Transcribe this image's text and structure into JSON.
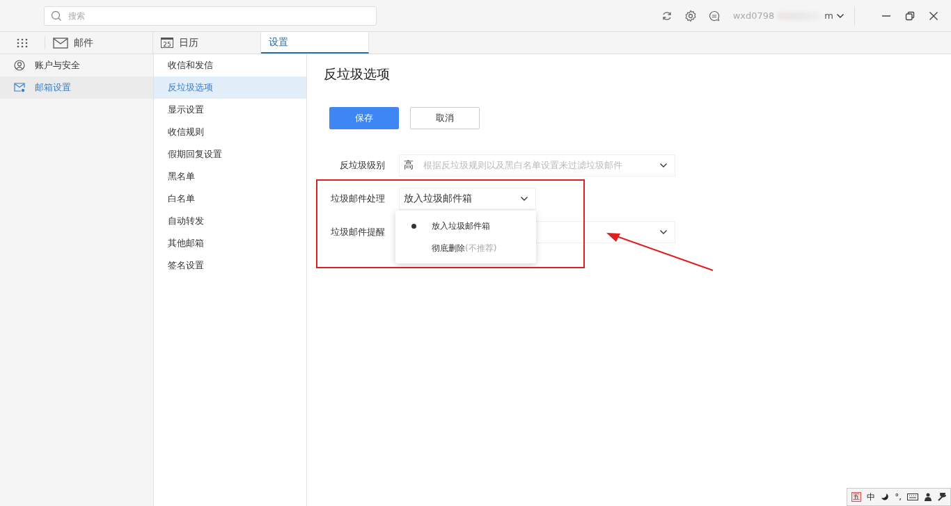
{
  "search": {
    "placeholder": "搜索"
  },
  "account": {
    "start": "wxd0798",
    "end": "m"
  },
  "tabs": [
    {
      "label": "邮件",
      "kind": "mail",
      "selected": false
    },
    {
      "label": "日历",
      "kind": "calendar",
      "day": "25",
      "selected": false
    },
    {
      "label": "设置",
      "kind": "plain",
      "selected": true
    }
  ],
  "sidebar": {
    "items": [
      {
        "label": "账户与安全",
        "kind": "user",
        "selected": false
      },
      {
        "label": "邮箱设置",
        "kind": "mail",
        "selected": true
      }
    ]
  },
  "submenu": {
    "items": [
      {
        "label": "收信和发信",
        "selected": false
      },
      {
        "label": "反垃圾选项",
        "selected": true
      },
      {
        "label": "显示设置",
        "selected": false
      },
      {
        "label": "收信规则",
        "selected": false
      },
      {
        "label": "假期回复设置",
        "selected": false
      },
      {
        "label": "黑名单",
        "selected": false
      },
      {
        "label": "白名单",
        "selected": false
      },
      {
        "label": "自动转发",
        "selected": false
      },
      {
        "label": "其他邮箱",
        "selected": false
      },
      {
        "label": "签名设置",
        "selected": false
      }
    ]
  },
  "content": {
    "title": "反垃圾选项",
    "buttons": [
      {
        "label": "保存",
        "kind": "primary"
      },
      {
        "label": "取消",
        "kind": "secondary"
      }
    ],
    "fields": [
      {
        "label": "反垃圾级别",
        "value": "高",
        "hint": "根据反垃圾规则以及黑白名单设置来过滤垃圾邮件",
        "kind": "wide"
      },
      {
        "label": "垃圾邮件处理",
        "value": "放入垃圾邮件箱",
        "kind": "narrow",
        "expanded": true
      },
      {
        "label": "垃圾邮件提醒",
        "kind": "wide"
      }
    ],
    "dropdown": {
      "options": [
        {
          "label": "放入垃圾邮件箱",
          "selected": true
        },
        {
          "label": "彻底删除",
          "note": "(不推荐)",
          "selected": false
        }
      ]
    }
  },
  "ime_toolbar": {
    "items": [
      {
        "label": "五",
        "kind": "boxed"
      },
      {
        "label": "中",
        "kind": "text"
      },
      {
        "kind": "moon"
      },
      {
        "label": "°,",
        "kind": "text"
      },
      {
        "kind": "keyboard"
      },
      {
        "kind": "person"
      },
      {
        "kind": "wrench"
      }
    ]
  }
}
